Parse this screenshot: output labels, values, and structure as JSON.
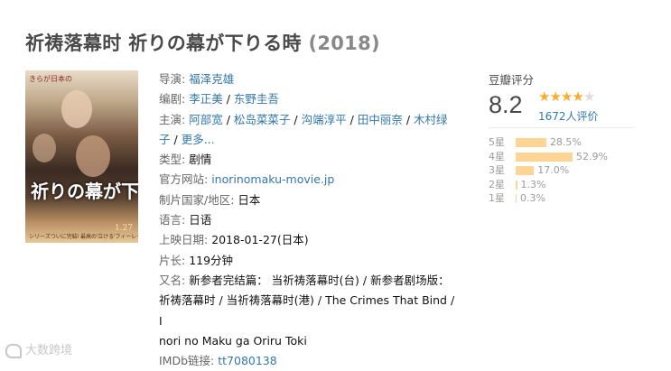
{
  "header": {
    "title": "祈祷落幕时 祈りの幕が下りる時",
    "year": "(2018)"
  },
  "poster": {
    "top_text": "きらが日本の",
    "title_text": "祈りの幕が下りる時",
    "date_text": "1.27",
    "bottom_text": "シリーズついに完結! 最高の'泣ける'フィーレー"
  },
  "info": {
    "director_label": "导演:",
    "director": "福泽克雄",
    "writer_label": "编剧:",
    "writers": [
      "李正美",
      "东野圭吾"
    ],
    "cast_label": "主演:",
    "cast_line1": [
      "阿部宽",
      "松岛菜菜子",
      "沟端淳平",
      "田中丽奈"
    ],
    "cast_line1_last": "木村绿",
    "cast_line2_first": "子",
    "more": "更多...",
    "genre_label": "类型:",
    "genre": "剧情",
    "website_label": "官方网站:",
    "website": "inorinomaku-movie.jp",
    "country_label": "制片国家/地区:",
    "country": "日本",
    "language_label": "语言:",
    "language": "日语",
    "release_label": "上映日期:",
    "release": "2018-01-27(日本)",
    "runtime_label": "片长:",
    "runtime": "119分钟",
    "aka_label": "又名:",
    "aka_line1": "新参者完结篇： 当祈祷落幕时(台) / 新参者剧场版：",
    "aka_line2": "祈祷落幕时 / 当祈祷落幕时(港) / The Crimes That Bind / I",
    "aka_line3": "nori no Maku ga Oriru Toki",
    "imdb_label": "IMDb链接:",
    "imdb": "tt7080138"
  },
  "rating": {
    "title": "豆瓣评分",
    "score": "8.2",
    "stars_full": 4,
    "stars_total": 5,
    "votes": "1672人评价",
    "distribution": [
      {
        "label": "5星",
        "percent": 28.5,
        "text": "28.5%"
      },
      {
        "label": "4星",
        "percent": 52.9,
        "text": "52.9%"
      },
      {
        "label": "3星",
        "percent": 17.0,
        "text": "17.0%"
      },
      {
        "label": "2星",
        "percent": 1.3,
        "text": "1.3%"
      },
      {
        "label": "1星",
        "percent": 0.3,
        "text": "0.3%"
      }
    ]
  },
  "watermark": {
    "text": "大数跨境"
  },
  "colors": {
    "link": "#3377aa",
    "star": "#ffac2d",
    "bar": "#ffd596",
    "title": "#494949"
  }
}
